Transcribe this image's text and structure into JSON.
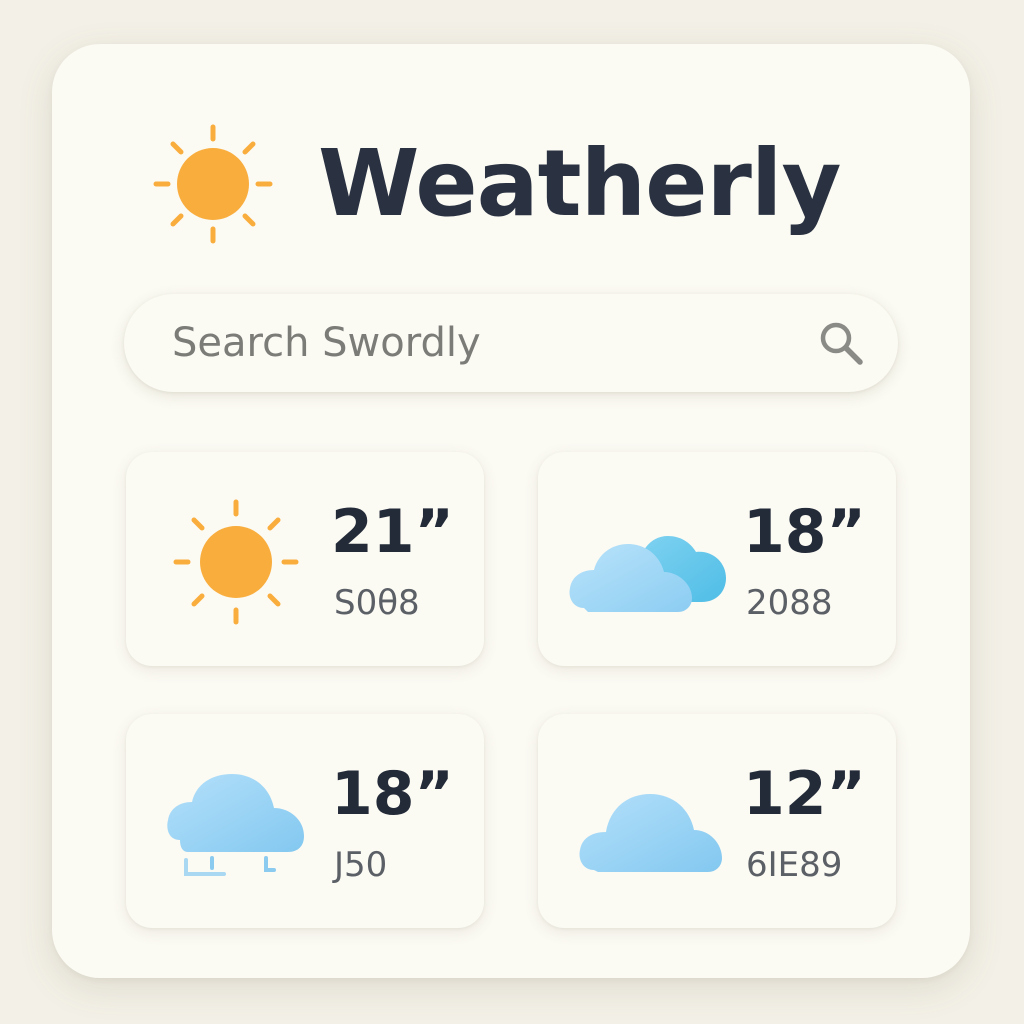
{
  "app": {
    "title": "Weatherly",
    "logo_icon": "sun-icon",
    "accent_color": "#f9ad3d"
  },
  "search": {
    "placeholder": "Search Swordly",
    "icon": "search-icon"
  },
  "cards": [
    {
      "temperature": "21”",
      "label": "S0θ8",
      "icon": "sun-icon"
    },
    {
      "temperature": "18”",
      "label": "2088",
      "icon": "cloudy-icon"
    },
    {
      "temperature": "18”",
      "label": "J50",
      "icon": "rain-cloud-icon"
    },
    {
      "temperature": "12”",
      "label": "6IE89",
      "icon": "cloud-icon"
    }
  ],
  "colors": {
    "sun": "#f9ad3d",
    "cloud_light": "#a8dcf6",
    "cloud_dark": "#5bc3e8",
    "title_text": "#2a3242"
  }
}
